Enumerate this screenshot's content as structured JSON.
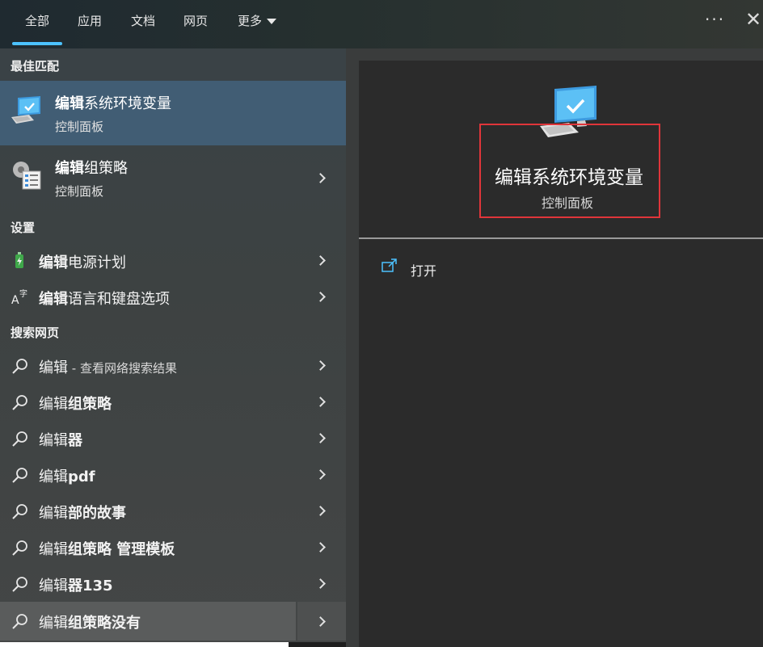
{
  "tabs": [
    {
      "label": "全部"
    },
    {
      "label": "应用"
    },
    {
      "label": "文档"
    },
    {
      "label": "网页"
    },
    {
      "label": "更多"
    }
  ],
  "window": {
    "more_options_label": "···",
    "close_label": "✕"
  },
  "sections": {
    "best_match": "最佳匹配",
    "settings": "设置",
    "web_search": "搜索网页"
  },
  "best_match_items": [
    {
      "bold": "编辑",
      "rest": "系统环境变量",
      "sub": "控制面板",
      "icon": "computer-check-icon"
    },
    {
      "bold": "编辑",
      "rest": "组策略",
      "sub": "控制面板",
      "icon": "group-policy-icon"
    }
  ],
  "settings_items": [
    {
      "bold": "编辑",
      "rest": "电源计划",
      "icon": "power-plan-icon"
    },
    {
      "bold": "编辑",
      "rest": "语言和键盘选项",
      "icon": "language-keyboard-icon"
    }
  ],
  "web_items": [
    {
      "plain": "编辑",
      "bold": "",
      "suffix": " - 查看网络搜索结果"
    },
    {
      "plain": "编辑",
      "bold": "组策略",
      "suffix": ""
    },
    {
      "plain": "编辑",
      "bold": "器",
      "suffix": ""
    },
    {
      "plain": "编辑",
      "bold": "pdf",
      "suffix": ""
    },
    {
      "plain": "编辑",
      "bold": "部的故事",
      "suffix": ""
    },
    {
      "plain": "编辑",
      "bold": "组策略 管理模板",
      "suffix": ""
    },
    {
      "plain": "编辑",
      "bold": "器135",
      "suffix": ""
    },
    {
      "plain": "编辑",
      "bold": "组策略没有",
      "suffix": ""
    }
  ],
  "detail": {
    "title": "编辑系统环境变量",
    "subtitle": "控制面板",
    "icon": "computer-check-icon",
    "actions": [
      {
        "label": "打开",
        "icon": "open-external-icon"
      }
    ]
  },
  "colors": {
    "accent": "#4cc2ff",
    "selected_bg": "#415d74",
    "highlight_border": "#e0353a"
  }
}
